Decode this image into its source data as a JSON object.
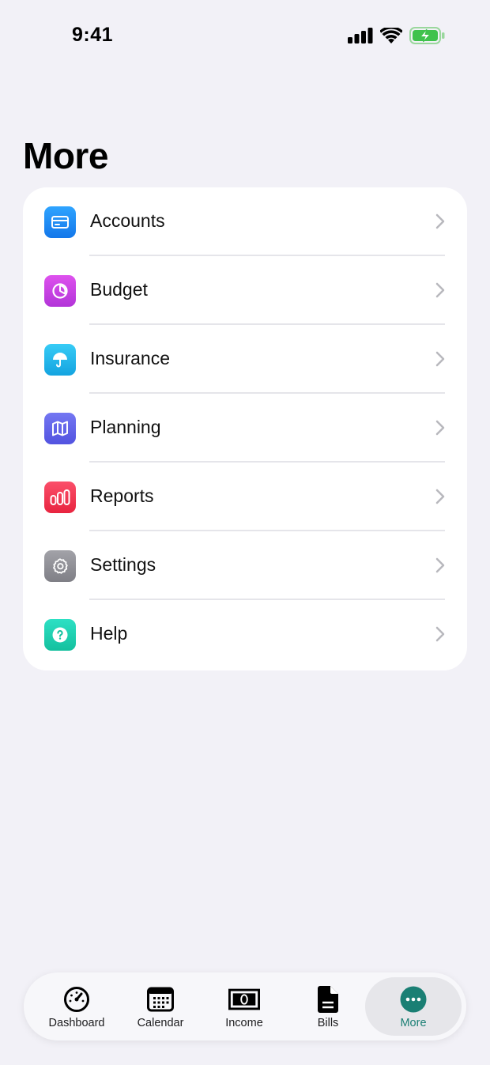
{
  "status_bar": {
    "time": "9:41"
  },
  "page": {
    "title": "More"
  },
  "menu": {
    "items": [
      {
        "label": "Accounts",
        "icon": "credit-card-icon",
        "color": "#1a8cf0"
      },
      {
        "label": "Budget",
        "icon": "pie-chart-icon",
        "color": "#c53fe0"
      },
      {
        "label": "Insurance",
        "icon": "umbrella-icon",
        "color": "#22b8ea"
      },
      {
        "label": "Planning",
        "icon": "map-icon",
        "color": "#5e63e8"
      },
      {
        "label": "Reports",
        "icon": "bar-chart-icon",
        "color": "#f0304f"
      },
      {
        "label": "Settings",
        "icon": "gear-icon",
        "color": "#8e8e93"
      },
      {
        "label": "Help",
        "icon": "question-icon",
        "color": "#1ecfb0"
      }
    ]
  },
  "tab_bar": {
    "tabs": [
      {
        "label": "Dashboard",
        "icon": "speedometer-icon"
      },
      {
        "label": "Calendar",
        "icon": "calendar-icon"
      },
      {
        "label": "Income",
        "icon": "banknote-icon"
      },
      {
        "label": "Bills",
        "icon": "document-icon"
      },
      {
        "label": "More",
        "icon": "ellipsis-circle-icon",
        "active": true
      }
    ],
    "active_color": "#1a7f74"
  }
}
